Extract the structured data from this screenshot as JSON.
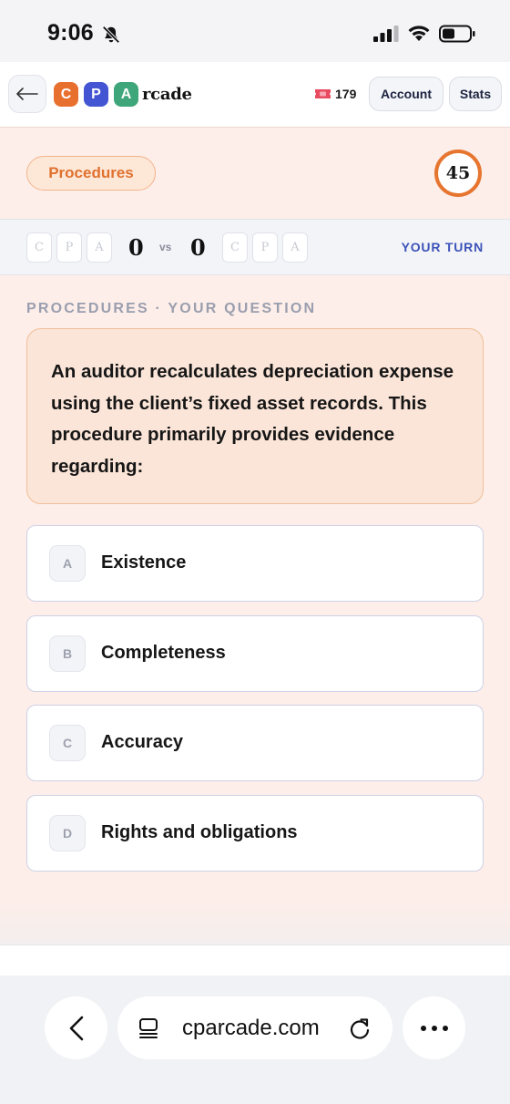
{
  "status_bar": {
    "time": "9:06",
    "icons": [
      "bell-slash-icon",
      "cellular-signal-icon",
      "wifi-icon",
      "battery-icon"
    ]
  },
  "header": {
    "logo": {
      "tiles": [
        {
          "letter": "C",
          "color": "#e8702f"
        },
        {
          "letter": "P",
          "color": "#4455d4"
        },
        {
          "letter": "A",
          "color": "#3fa57a"
        }
      ],
      "rest": "rcade"
    },
    "tickets": {
      "icon": "ticket-icon",
      "count": "179"
    },
    "account_label": "Account",
    "stats_label": "Stats"
  },
  "game": {
    "category": "Procedures",
    "timer": "45",
    "player1": {
      "letters": [
        "C",
        "P",
        "A"
      ],
      "score": "0"
    },
    "vs": "vs",
    "player2": {
      "letters": [
        "C",
        "P",
        "A"
      ],
      "score": "0"
    },
    "turn": "YOUR TURN"
  },
  "question": {
    "label": "PROCEDURES · YOUR QUESTION",
    "text": "An auditor recalculates depreciation expense using the client’s fixed asset records. This procedure primarily provides evidence regarding:",
    "options": [
      {
        "letter": "A",
        "text": "Existence"
      },
      {
        "letter": "B",
        "text": "Completeness"
      },
      {
        "letter": "C",
        "text": "Accuracy"
      },
      {
        "letter": "D",
        "text": "Rights and obligations"
      }
    ]
  },
  "browser": {
    "url": "cparcade.com"
  },
  "colors": {
    "accent_orange": "#e6752f",
    "accent_blue": "#3c53b8",
    "background": "#fdeee9"
  }
}
